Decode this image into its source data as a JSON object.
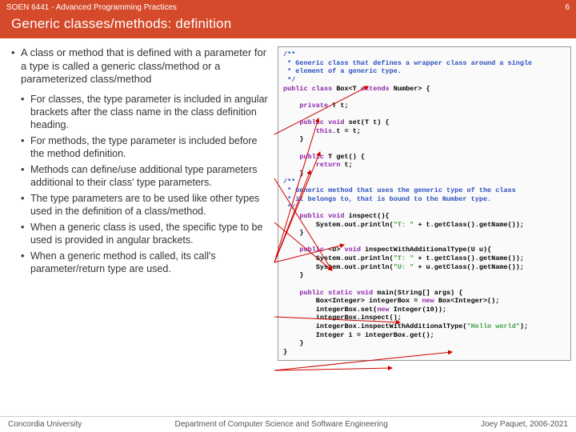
{
  "meta": {
    "courseCode": "SOEN 6441 - Advanced Programming Practices",
    "pageNum": "6",
    "slideTitle": "Generic classes/methods: definition"
  },
  "main": {
    "intro": "A class or method that is defined with a parameter for a type is called a generic class/method or a parameterized class/method",
    "subs": [
      "For classes, the type parameter is included in angular brackets after the class name in the class definition heading.",
      "For methods, the type parameter is included before the method definition.",
      "Methods can define/use additional type parameters additional to their class' type parameters.",
      "The type parameters are to be used like other types used in the definition of a class/method.",
      "When a generic class is used, the specific type to be used is provided in angular brackets.",
      "When a generic method is called, its call's parameter/return type are used."
    ]
  },
  "code": {
    "c01a": "/**",
    "c01b": " * Generic class that defines a wrapper class around a single",
    "c01c": " * element of a generic type.",
    "c01d": " */",
    "c02a": "public",
    "c02b": " ",
    "c02c": "class",
    "c02d": " Box<T ",
    "c02e": "extends",
    "c02f": " Number> {",
    "c03": "",
    "c04a": "    ",
    "c04b": "private",
    "c04c": " T t;",
    "c05": "",
    "c06a": "    ",
    "c06b": "public",
    "c06c": " ",
    "c06d": "void",
    "c06e": " set(T t) {",
    "c07a": "        ",
    "c07b": "this",
    "c07c": ".t = t;",
    "c08": "    }",
    "c09": "",
    "c10a": "    ",
    "c10b": "public",
    "c10c": " T get() {",
    "c11a": "        ",
    "c11b": "return",
    "c11c": " t;",
    "c12": "    }",
    "c13a": "/**",
    "c13b": " * Generic method that uses the generic type of the class",
    "c13c": " * it belongs to, that is bound to the Number type.",
    "c13d": " */",
    "c14a": "    ",
    "c14b": "public",
    "c14c": " ",
    "c14d": "void",
    "c14e": " inspect(){",
    "c15a": "        System.out.println(",
    "c15b": "\"T: \"",
    "c15c": " + t.getClass().getName());",
    "c16": "    }",
    "c17": "",
    "c18a": "    ",
    "c18b": "public",
    "c18c": " <U> ",
    "c18d": "void",
    "c18e": " inspectWithAdditionalType(U u){",
    "c19a": "        System.out.println(",
    "c19b": "\"T: \"",
    "c19c": " + t.getClass().getName());",
    "c20a": "        System.out.println(",
    "c20b": "\"U: \"",
    "c20c": " + u.getClass().getName());",
    "c21": "    }",
    "c22": "",
    "c23a": "    ",
    "c23b": "public",
    "c23c": " ",
    "c23d": "static",
    "c23e": " ",
    "c23f": "void",
    "c23g": " main(String[] args) {",
    "c24a": "        Box<Integer> integerBox = ",
    "c24b": "new",
    "c24c": " Box<Integer>();",
    "c25a": "        integerBox.set(",
    "c25b": "new",
    "c25c": " Integer(10));",
    "c26": "        integerBox.inspect();",
    "c27a": "        integerBox.inspectWithAdditionalType(",
    "c27b": "\"Hello world\"",
    "c27c": ");",
    "c28": "        Integer i = integerBox.get();",
    "c29": "    }",
    "c30": "}"
  },
  "footer": {
    "left": "Concordia University",
    "center": "Department of Computer Science and Software Engineering",
    "right": "Joey Paquet, 2006-2021"
  }
}
